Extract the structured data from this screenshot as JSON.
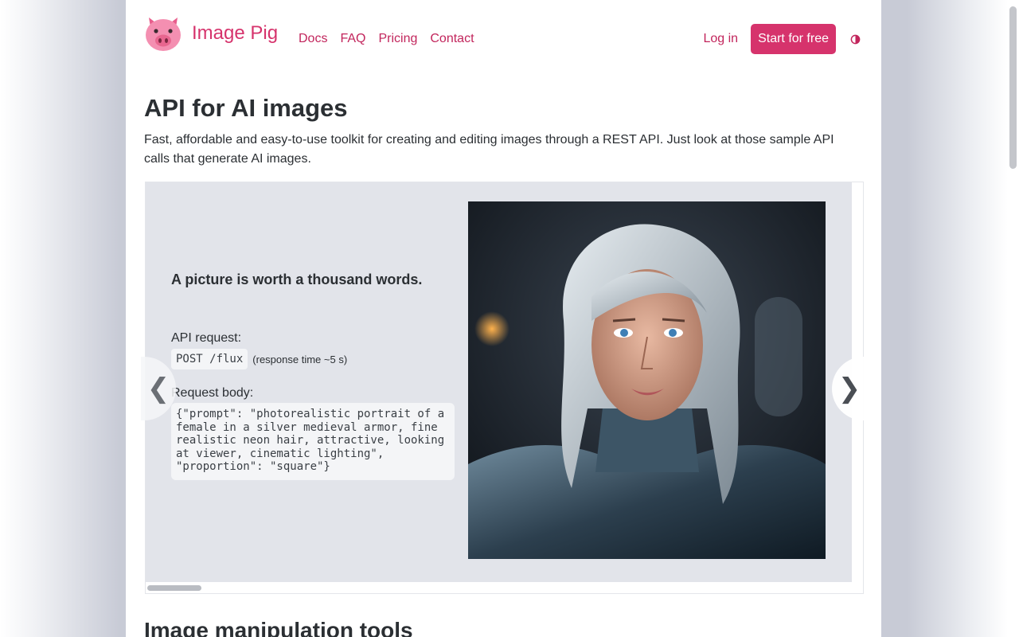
{
  "header": {
    "brand_name": "Image Pig",
    "nav": [
      "Docs",
      "FAQ",
      "Pricing",
      "Contact"
    ],
    "login_label": "Log in",
    "cta_label": "Start for free"
  },
  "hero": {
    "title": "API for AI images",
    "lead": "Fast, affordable and easy-to-use toolkit for creating and editing images through a REST API. Just look at those sample API calls that generate AI images."
  },
  "carousel": {
    "tagline": "A picture is worth a thousand words.",
    "request_label": "API request:",
    "endpoint": "POST /flux",
    "response_time": "(response time ~5 s)",
    "body_label": "Request body:",
    "body": "{\"prompt\": \"photorealistic portrait of a female in a silver medieval armor, fine realistic neon hair, attractive, looking at viewer, cinematic lighting\", \"proportion\": \"square\"}",
    "prev_symbol": "❮",
    "next_symbol": "❯"
  },
  "section": {
    "title": "Image manipulation tools"
  },
  "colors": {
    "brand": "#d6336c",
    "slide_bg": "#e2e4ea"
  },
  "icons": [
    "pig-logo-icon",
    "contrast-toggle-icon",
    "chevron-left-icon",
    "chevron-right-icon"
  ]
}
